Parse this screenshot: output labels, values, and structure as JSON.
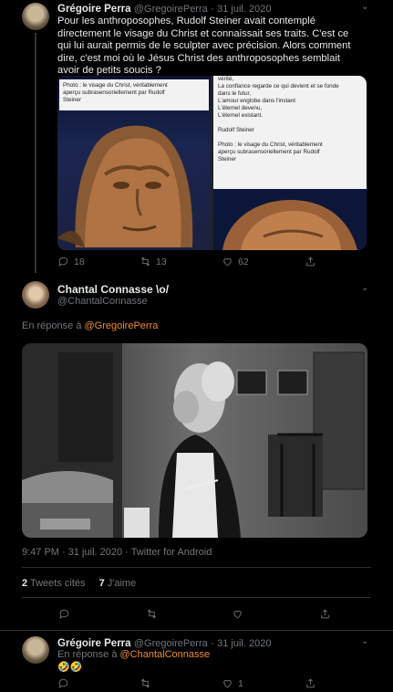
{
  "tweet1": {
    "author_name": "Grégoire Perra",
    "handle": "@GregoirePerra",
    "separator": "·",
    "date": "31 juil. 2020",
    "lines": [
      "Pour les anthroposophes, Rudolf Steiner avait contemplé",
      "directement le visage du Christ et connaissait ses traits. C'est ce",
      "qui lui aurait permis de le sculpter avec précision. Alors comment",
      "dire, c'est moi où  le Jésus Christ des anthroposophes semblait",
      "avoir de petits soucis ?"
    ],
    "image_left_caption": [
      "Photo : le visage du Christ, véritablement",
      "aperçu subrasensoriellement par Rudolf",
      "Steiner"
    ],
    "image_right_text": [
      "vérité,",
      "La confiance regarde ce qui devient et se fonde",
      "dans le futur,",
      "L'amour englobe dans l'instant",
      "L'éternel devenu,",
      "L'éternel existant.",
      "",
      "Rudolf Steiner",
      "",
      "Photo : le visage du Christ, véritablement",
      "aperçu subrasensoriellement par Rudolf",
      "Steiner"
    ],
    "replies": "18",
    "retweets": "13",
    "likes": "62"
  },
  "tweet2": {
    "author_name": "Chantal Connasse \\o/",
    "handle": "@ChantalConnasse",
    "reply_prefix": "En réponse à",
    "reply_to": "@GregoirePerra",
    "time": "9:47 PM",
    "date": "31 juil. 2020",
    "source": "Twitter for Android",
    "quote_count": "2",
    "quote_label": "Tweets cités",
    "like_count": "7",
    "like_label": "J'aime"
  },
  "tweet3": {
    "author_name": "Grégoire Perra",
    "handle": "@GregoirePerra",
    "separator": "·",
    "date": "31 juil. 2020",
    "reply_prefix": "En réponse à",
    "reply_to": "@ChantalConnasse",
    "emoji": "🤣🤣",
    "likes": "1"
  },
  "icons": {
    "reply": "reply-icon",
    "retweet": "retweet-icon",
    "like": "heart-icon",
    "share": "share-icon",
    "more": "chevron-down-icon"
  },
  "colors": {
    "background": "#000000",
    "link": "#f28c28",
    "muted": "#71767b"
  }
}
